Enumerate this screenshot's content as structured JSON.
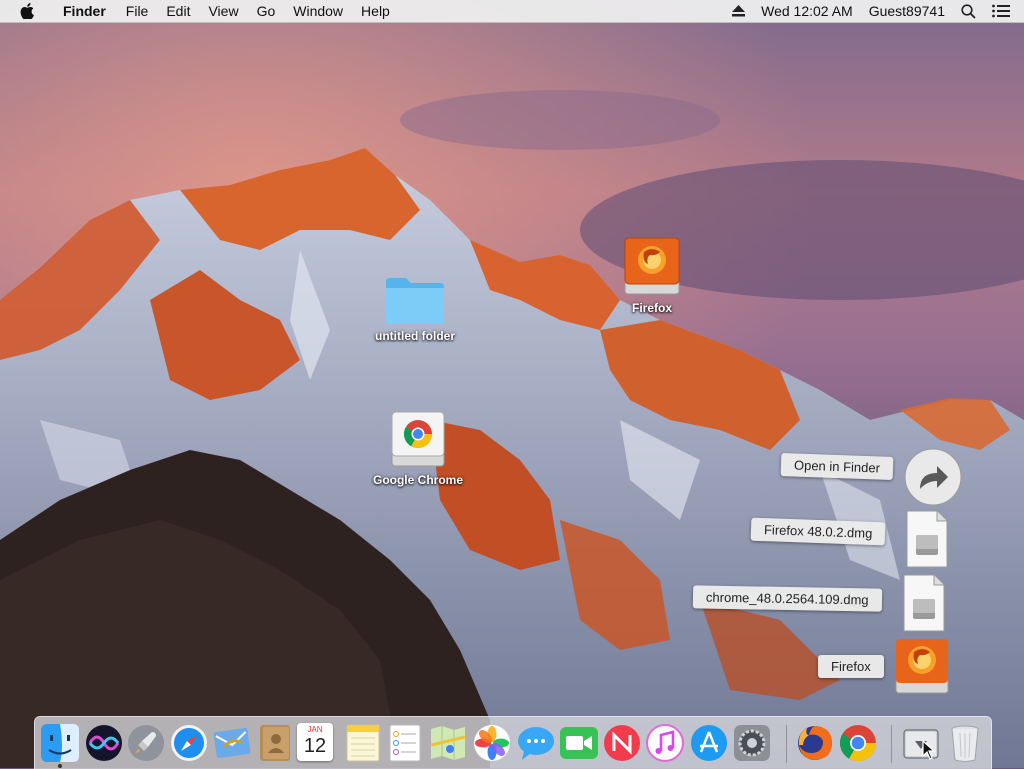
{
  "menubar": {
    "app_name": "Finder",
    "menus": [
      "File",
      "Edit",
      "View",
      "Go",
      "Window",
      "Help"
    ],
    "clock": "Wed 12:02 AM",
    "user": "Guest89741"
  },
  "desktop": {
    "icons": {
      "untitled_folder": "untitled folder",
      "firefox_volume": "Firefox",
      "google_chrome": "Google Chrome"
    }
  },
  "downloads_stack": {
    "open_in_finder": "Open in Finder",
    "items": [
      "Firefox 48.0.2.dmg",
      "chrome_48.0.2564.109.dmg",
      "Firefox"
    ]
  },
  "calendar_icon": {
    "month": "JAN",
    "day": "12"
  },
  "dock": {
    "apps": [
      "finder-icon",
      "siri-icon",
      "launchpad-icon",
      "safari-icon",
      "mail-icon",
      "contacts-icon",
      "calendar-icon",
      "notes-icon",
      "reminders-icon",
      "maps-icon",
      "photos-icon",
      "messages-icon",
      "facetime-icon",
      "news-icon",
      "itunes-icon",
      "app-store-icon",
      "system-preferences-icon",
      "firefox-icon",
      "chrome-icon",
      "downloads-stack-icon",
      "trash-icon"
    ]
  },
  "colors": {
    "menubar_bg": "#ececec",
    "label_bg": "#ebebeb",
    "folder_blue": "#6cc3f5",
    "firefox_orange": "#e8641b"
  }
}
